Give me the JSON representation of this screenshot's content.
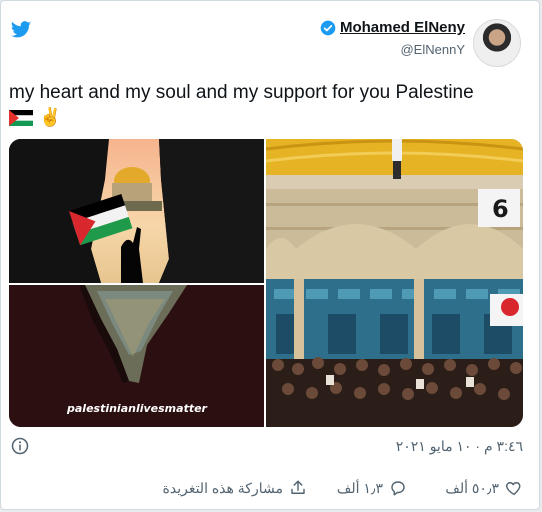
{
  "tweet": {
    "author_name": "Mohamed ElNeny",
    "author_handle": "@ElNennY",
    "text": "my heart and my soul and my support for you  Palestine",
    "emoji_flag": "palestine-flag-icon",
    "emoji_peace": "✌️",
    "image_caption": "palestinianlivesmatter",
    "timestamp": "٣:٤٦ م · ١٠ مايو ٢٠٢١"
  },
  "actions": {
    "like_count": "٥٠٫٣ ألف",
    "reply_count": "١٫٣ ألف",
    "share_label": "مشاركة هذه التغريدة"
  },
  "colors": {
    "twitter_blue": "#1d9bf0",
    "text_primary": "#0f1419",
    "text_secondary": "#536471",
    "dome_gold": "#e6b325"
  },
  "icons": {
    "logo": "twitter-bird-icon",
    "verified": "verified-badge-icon",
    "info": "info-icon",
    "like": "heart-icon",
    "reply": "reply-bubble-icon",
    "share": "share-upload-icon"
  }
}
